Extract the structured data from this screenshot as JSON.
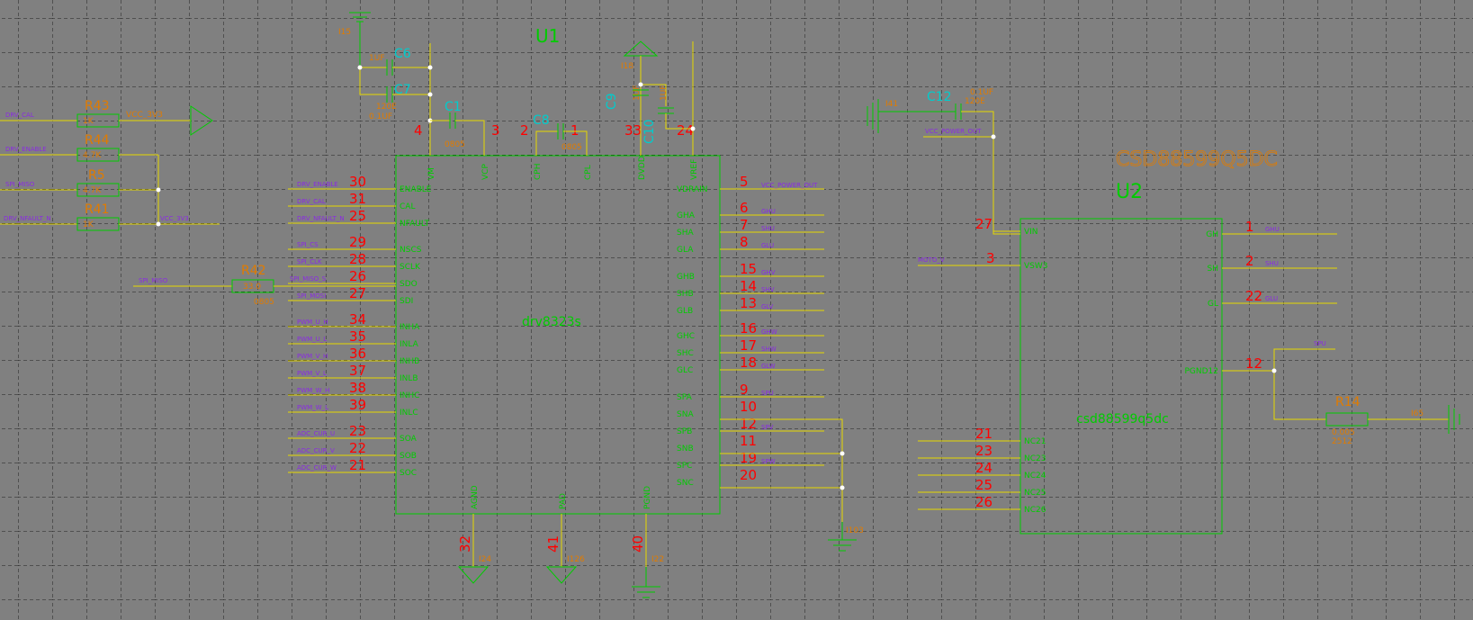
{
  "colors": {
    "background": "#808080",
    "grid": "#202020",
    "component_body": "#00cc00",
    "wire": "#e6d800",
    "pin_number": "#ff0000",
    "net_label": "#8a2be2",
    "ref_designator": "#e07b00",
    "cap_designator": "#00cccc"
  },
  "u1": {
    "ref": "U1",
    "part": "drv8323s",
    "left_pins": [
      {
        "num": "30",
        "name": "ENABLE",
        "net": "DRV_ENABLE"
      },
      {
        "num": "31",
        "name": "CAL",
        "net": "DRV_CAL"
      },
      {
        "num": "25",
        "name": "NFAULT",
        "net": "DRV_NFAULT_N"
      },
      {
        "num": "29",
        "name": "NSCS",
        "net": "SPI_CS"
      },
      {
        "num": "28",
        "name": "SCLK",
        "net": "SPI_CLK"
      },
      {
        "num": "26",
        "name": "SDO",
        "net": "SPI_MISO_S"
      },
      {
        "num": "27",
        "name": "SDI",
        "net": "SPI_MOSI"
      },
      {
        "num": "34",
        "name": "INHA",
        "net": "PWM_U_H"
      },
      {
        "num": "35",
        "name": "INLA",
        "net": "PWM_U_L"
      },
      {
        "num": "36",
        "name": "INHB",
        "net": "PWM_V_H"
      },
      {
        "num": "37",
        "name": "INLB",
        "net": "PWM_V_L"
      },
      {
        "num": "38",
        "name": "INHC",
        "net": "PWM_W_H"
      },
      {
        "num": "39",
        "name": "INLC",
        "net": "PWM_W_L"
      },
      {
        "num": "23",
        "name": "SOA",
        "net": "ADC_CUR_U"
      },
      {
        "num": "22",
        "name": "SOB",
        "net": "ADC_CUR_V"
      },
      {
        "num": "21",
        "name": "SOC",
        "net": "ADC_CUR_W"
      }
    ],
    "right_pins": [
      {
        "num": "5",
        "name": "VDRAIN",
        "net": "VCC_POWER_OUT"
      },
      {
        "num": "6",
        "name": "GHA",
        "net": "GHU"
      },
      {
        "num": "7",
        "name": "SHA",
        "net": "SHU"
      },
      {
        "num": "8",
        "name": "GLA",
        "net": "GLU"
      },
      {
        "num": "15",
        "name": "GHB",
        "net": "GHV"
      },
      {
        "num": "14",
        "name": "SHB",
        "net": "SHV"
      },
      {
        "num": "13",
        "name": "GLB",
        "net": "GLV"
      },
      {
        "num": "16",
        "name": "GHC",
        "net": "GHW"
      },
      {
        "num": "17",
        "name": "SHC",
        "net": "SHW"
      },
      {
        "num": "18",
        "name": "GLC",
        "net": "GLW"
      },
      {
        "num": "9",
        "name": "SPA",
        "net": "SPU"
      },
      {
        "num": "10",
        "name": "SNA",
        "net": ""
      },
      {
        "num": "12",
        "name": "SPB",
        "net": "SPV"
      },
      {
        "num": "11",
        "name": "SNB",
        "net": ""
      },
      {
        "num": "19",
        "name": "SPC",
        "net": "SPW"
      },
      {
        "num": "20",
        "name": "SNC",
        "net": ""
      }
    ],
    "top_pins": [
      {
        "num": "4",
        "name": "VM"
      },
      {
        "num": "3",
        "name": "VCP"
      },
      {
        "num": "2",
        "name": "CPH"
      },
      {
        "num": "1",
        "name": "CPL"
      },
      {
        "num": "33",
        "name": "DVDD"
      },
      {
        "num": "24",
        "name": "VREF"
      }
    ],
    "bottom_pins": [
      {
        "num": "32",
        "name": "AGND",
        "net": "I24"
      },
      {
        "num": "41",
        "name": "PAD",
        "net": "I126"
      },
      {
        "num": "40",
        "name": "PGND",
        "net": "I22"
      }
    ]
  },
  "u2": {
    "ref": "U2",
    "part": "csd88599q5dc",
    "value": "CSD88599Q5DC",
    "left_pins": [
      {
        "num": "27",
        "name": "VIN"
      },
      {
        "num": "3",
        "name": "VSW3",
        "net": "MOTO_V"
      },
      {
        "num": "21",
        "name": "NC21"
      },
      {
        "num": "23",
        "name": "NC23"
      },
      {
        "num": "24",
        "name": "NC24"
      },
      {
        "num": "25",
        "name": "NC25"
      },
      {
        "num": "26",
        "name": "NC26"
      }
    ],
    "right_pins": [
      {
        "num": "1",
        "name": "GH",
        "net": "GHU"
      },
      {
        "num": "2",
        "name": "SH",
        "net": "SHU"
      },
      {
        "num": "22",
        "name": "GL",
        "net": "GLU"
      },
      {
        "num": "12",
        "name": "PGND12",
        "net": "SPU"
      }
    ]
  },
  "resistors": [
    {
      "ref": "R43",
      "value": "1K",
      "net": "DRV_CAL"
    },
    {
      "ref": "R44",
      "value": "4.7K",
      "net": "DRV_ENABLE"
    },
    {
      "ref": "R5",
      "value": "4.7K",
      "net": "SPI_MISO"
    },
    {
      "ref": "R41",
      "value": "1K",
      "net": "DRV_NFAULT_N"
    },
    {
      "ref": "R42",
      "value": "33.0",
      "pkg": "0805",
      "net": "SPI_MISO"
    },
    {
      "ref": "R14",
      "value": "0.005",
      "pkg": "2512"
    }
  ],
  "capacitors": [
    {
      "ref": "C6",
      "value": "1UF"
    },
    {
      "ref": "C7",
      "value": "0.1UF"
    },
    {
      "ref": "C1",
      "value": "0805"
    },
    {
      "ref": "C8",
      "value": "0805"
    },
    {
      "ref": "C9",
      "value": "1UF"
    },
    {
      "ref": "C10",
      "value": "1UF"
    },
    {
      "ref": "C12",
      "value": "0.1UF"
    }
  ],
  "nets": {
    "vcc_3v3": "VCC_3V3",
    "vcc_power_out": "VCC_POWER_OUT",
    "i15": "I15",
    "i18": "I18",
    "i41": "I41",
    "i103": "I103",
    "i65": "I65",
    "pkg_120e": "120E"
  }
}
